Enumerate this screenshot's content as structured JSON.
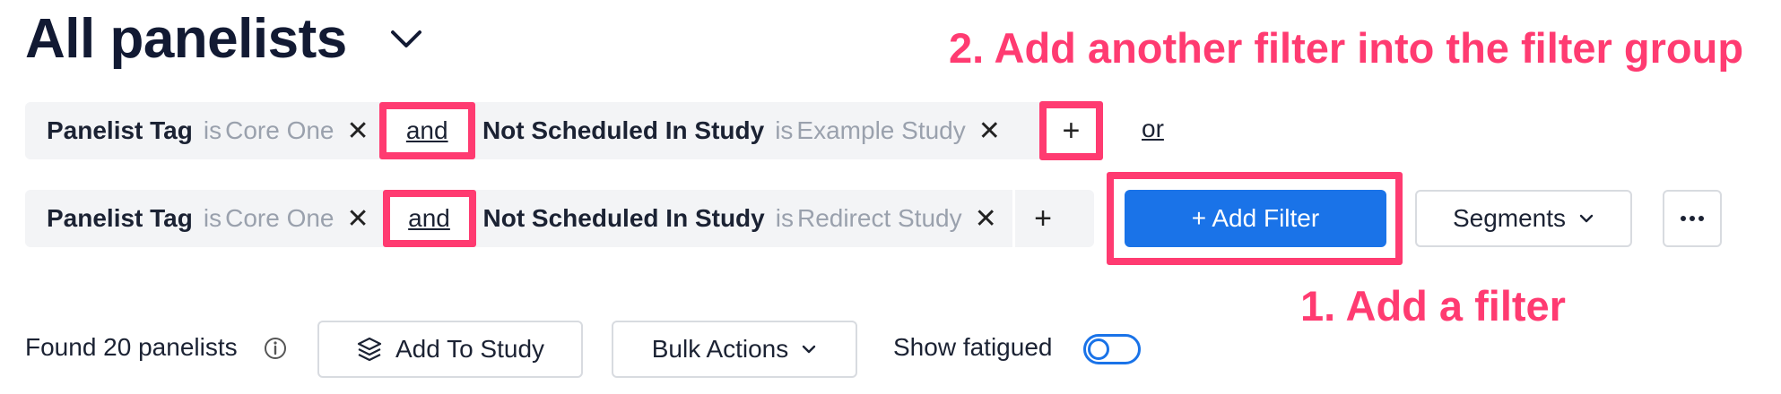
{
  "header": {
    "title": "All panelists",
    "dropdown_icon": "chevron-down-icon"
  },
  "filter_groups": [
    {
      "filters": [
        {
          "field": "Panelist Tag",
          "operator": "is",
          "value": "Core One",
          "remove_icon": "close-icon"
        },
        {
          "field": "Not Scheduled In Study",
          "operator": "is",
          "value": "Example Study",
          "remove_icon": "close-icon"
        }
      ],
      "joiner": "and",
      "add_icon": "plus-icon",
      "group_joiner": "or"
    },
    {
      "filters": [
        {
          "field": "Panelist Tag",
          "operator": "is",
          "value": "Core One",
          "remove_icon": "close-icon"
        },
        {
          "field": "Not Scheduled In Study",
          "operator": "is",
          "value": "Redirect Study",
          "remove_icon": "close-icon"
        }
      ],
      "joiner": "and",
      "add_icon": "plus-icon"
    }
  ],
  "toolbar": {
    "add_filter_label": "+ Add Filter",
    "segments_label": "Segments",
    "more_icon": "more-horizontal-icon"
  },
  "results": {
    "found_text": "Found 20 panelists",
    "info_icon": "info-icon",
    "add_to_study_label": "Add To Study",
    "add_to_study_icon": "layers-icon",
    "bulk_actions_label": "Bulk Actions",
    "show_fatigued_label": "Show fatigued",
    "show_fatigued_on": false
  },
  "annotations": {
    "step1": "1. Add a filter",
    "step2": "2. Add another filter into the filter group",
    "highlight_color": "#ff3b71"
  },
  "colors": {
    "accent": "#1a73e8",
    "highlight": "#ff3b71",
    "muted_text": "#9aa1ad"
  }
}
